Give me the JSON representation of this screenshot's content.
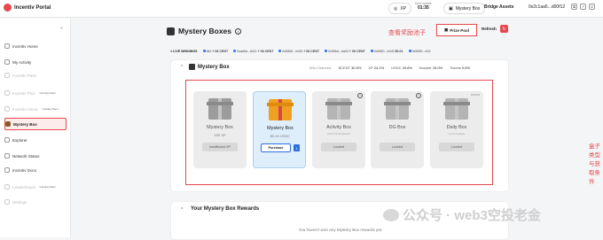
{
  "header": {
    "logo": "Incentiv Portal",
    "xp": "XP",
    "updated_label": "Next update",
    "updated_value": "01:35",
    "mystery_box": "Mystery Box",
    "bridge": "Bridge Assets",
    "wallet": "0x2c1aa5...d00f12"
  },
  "sidebar": {
    "items": [
      {
        "label": "Incentiv Home",
        "dim": false,
        "badge": ""
      },
      {
        "label": "My Activity",
        "dim": false,
        "badge": ""
      },
      {
        "label": "Incentiv Pass",
        "dim": true,
        "badge": ""
      },
      {
        "label": "Incentiv Plus",
        "dim": true,
        "badge": "Coming Soon"
      },
      {
        "label": "Incentiv Arena",
        "dim": true,
        "badge": "Coming Soon"
      },
      {
        "label": "Mystery Box",
        "dim": false,
        "badge": "",
        "active": true
      },
      {
        "label": "Explorer",
        "dim": false,
        "badge": ""
      },
      {
        "label": "Network Status",
        "dim": false,
        "badge": ""
      },
      {
        "label": "Incentiv Docs",
        "dim": false,
        "badge": ""
      },
      {
        "label": "Leaderboard",
        "dim": true,
        "badge": "Coming Soon"
      },
      {
        "label": "Settings",
        "dim": true,
        "badge": ""
      }
    ]
  },
  "page": {
    "title": "Mystery Boxes",
    "annotation_prize": "查看奖励池子",
    "prize_pool": "Prize Pool",
    "refresh": "Refresh"
  },
  "ticker": {
    "live": "LIVE WINNINGS",
    "items": [
      {
        "addr": "dk0",
        "amount": "+ 08 CENT"
      },
      {
        "addr": "0xad0a...6c11",
        "amount": "+ 08 CENT"
      },
      {
        "addr": "0x5550...e2d3",
        "amount": "+ 08 CENT"
      },
      {
        "addr": "0x50bd...ba03",
        "amount": "+ 08 CENT"
      },
      {
        "addr": "0x5550...e2d3",
        "amount": "$0.01"
      },
      {
        "addr": "0x5550...e2d",
        "amount": ""
      }
    ]
  },
  "mystery_box": {
    "title": "Mystery Box",
    "win_chances": "Win Chances:",
    "stats": [
      {
        "label": "$CENT",
        "value": "30.5%"
      },
      {
        "label": "XP",
        "value": "24.1%"
      },
      {
        "label": "USDC",
        "value": "20.8%"
      },
      {
        "label": "Booster",
        "value": "15.0%"
      },
      {
        "label": "Tickets",
        "value": "9.6%"
      }
    ],
    "boxes": [
      {
        "name": "Mystery Box",
        "sub": "150 XP",
        "button": "Insufficient XP",
        "state": "disabled"
      },
      {
        "name": "Mystery Box",
        "sub": "$0.44 USDC",
        "button": "Purchase",
        "state": "purchase",
        "qty": "1"
      },
      {
        "name": "Activity Box",
        "sub": "Lost of 10 transactions",
        "button": "Locked",
        "state": "locked"
      },
      {
        "name": "DG Box",
        "sub": "",
        "button": "Locked",
        "state": "locked"
      },
      {
        "name": "Daily Box",
        "sub": "Lost of 5 actions",
        "button": "Locked",
        "state": "locked",
        "count": "00:00:00"
      }
    ]
  },
  "annotation_boxes": "盒子类型与获取条件",
  "rewards": {
    "title": "Your Mystery Box Rewards",
    "empty": "You haven't won any Mystery Box rewards yet."
  },
  "watermark": "公众号 · web3空投老金"
}
